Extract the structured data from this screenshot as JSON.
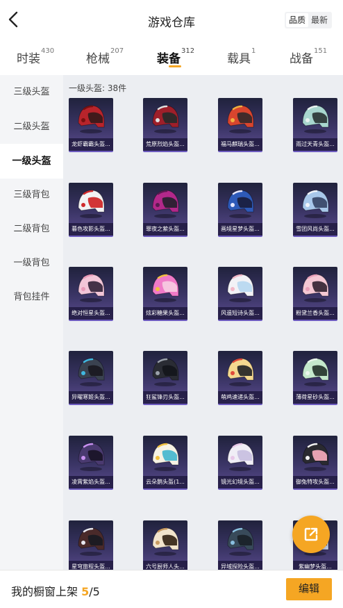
{
  "header": {
    "title": "游戏仓库",
    "sort_options": [
      "品质",
      "最新"
    ],
    "active_sort": "品质"
  },
  "tabs": [
    {
      "label": "时装",
      "count": "430"
    },
    {
      "label": "枪械",
      "count": "207"
    },
    {
      "label": "装备",
      "count": "312",
      "active": true
    },
    {
      "label": "载具",
      "count": "1"
    },
    {
      "label": "战备",
      "count": "151"
    }
  ],
  "sidebar": {
    "items": [
      "三级头盔",
      "二级头盔",
      "一级头盔",
      "三级背包",
      "二级背包",
      "一级背包",
      "背包挂件"
    ],
    "active": "一级头盔"
  },
  "main": {
    "count_label": "一级头盔: 38件"
  },
  "items": [
    {
      "name": "龙虾霸霸头盔...",
      "color": "#b8242b",
      "visor": "#3a1a1a",
      "accent": "#7a1010"
    },
    {
      "name": "荒原烈焰头盔...",
      "color": "#9e1f2a",
      "visor": "#2a2a2a",
      "accent": "#e0e0e0"
    },
    {
      "name": "福马麒瑞头盔...",
      "color": "#d8452e",
      "visor": "#3a2a2a",
      "accent": "#f0b040"
    },
    {
      "name": "雨过天青头盔...",
      "color": "#a8d6cf",
      "visor": "#2e3a3a",
      "accent": "#e8f2f0"
    },
    {
      "name": "暮色攻影头盔...",
      "color": "#f2f2f2",
      "visor": "#d02a2a",
      "accent": "#d02a2a"
    },
    {
      "name": "罪夜之萦头盔...",
      "color": "#b2288a",
      "visor": "#2a2030",
      "accent": "#5a1a50"
    },
    {
      "name": "画境星梦头盔...",
      "color": "#2e5ab8",
      "visor": "#1a2040",
      "accent": "#e8e8ff"
    },
    {
      "name": "雪团风尚头盔...",
      "color": "#a8c8ea",
      "visor": "#3a4a6a",
      "accent": "#f0f4fa"
    },
    {
      "name": "绝对恒星头盔...",
      "color": "#f2c6d8",
      "visor": "#3a2a40",
      "accent": "#e89ab8"
    },
    {
      "name": "炫彩糖果头盔...",
      "color": "#f07ac8",
      "visor": "#f6c8e0",
      "accent": "#f0c040"
    },
    {
      "name": "风遥短诗头盔...",
      "color": "#f2f2f6",
      "visor": "#b8d8f0",
      "accent": "#f2b8c8"
    },
    {
      "name": "粉黛兰香头盔...",
      "color": "#f4c8d4",
      "visor": "#3a2a38",
      "accent": "#e8a0b8"
    },
    {
      "name": "异曜寒姬头盔...",
      "color": "#3a4250",
      "visor": "#1a1a22",
      "accent": "#40b8e0"
    },
    {
      "name": "狂鲨锋刃头盔...",
      "color": "#2a2c34",
      "visor": "#14161c",
      "accent": "#9aa0aa"
    },
    {
      "name": "萌鸡速递头盔...",
      "color": "#f4d890",
      "visor": "#2a2a2a",
      "accent": "#e04a3a"
    },
    {
      "name": "薄荷星砂头盔...",
      "color": "#c4e8cc",
      "visor": "#2a3a30",
      "accent": "#eaf6ec"
    },
    {
      "name": "凌霄紫焰头盔...",
      "color": "#4a3a70",
      "visor": "#1a1428",
      "accent": "#c890f0"
    },
    {
      "name": "云朵鹅头盔(1...",
      "color": "#f6f2e4",
      "visor": "#4ab8d0",
      "accent": "#f0c040"
    },
    {
      "name": "镜光幻境头盔...",
      "color": "#f0eef6",
      "visor": "#c8c0e0",
      "accent": "#e8c8e8"
    },
    {
      "name": "御兔特攻头盔...",
      "color": "#2a2a30",
      "visor": "#f0a8b8",
      "accent": "#f4f4f4"
    },
    {
      "name": "星穹旅程头盔...",
      "color": "#4a2a2a",
      "visor": "#1a1a22",
      "accent": "#e8e8f0"
    },
    {
      "name": "六号厨师人头...",
      "color": "#f2e4cc",
      "visor": "#3a2a1a",
      "accent": "#c89a60"
    },
    {
      "name": "异域探险头盔...",
      "color": "#384a5a",
      "visor": "#1a222a",
      "accent": "#8ac0e0"
    },
    {
      "name": "紫幽梦头盔...",
      "color": "#c8d4f0",
      "visor": "#2a2a3a",
      "accent": "#f0f0f8"
    }
  ],
  "footer": {
    "showcase_label": "我的橱窗上架",
    "showcase_current": "5",
    "showcase_total": "/5",
    "edit_label": "编辑"
  },
  "icons": {
    "back": "chevron-left-icon",
    "share": "share-icon"
  },
  "colors": {
    "accent": "#f5a623",
    "sidebar_bg": "#f4f5f7",
    "main_bg": "#eceef2",
    "card_gradient_top": "#20223c",
    "card_gradient_bottom": "#5a4b8e"
  }
}
